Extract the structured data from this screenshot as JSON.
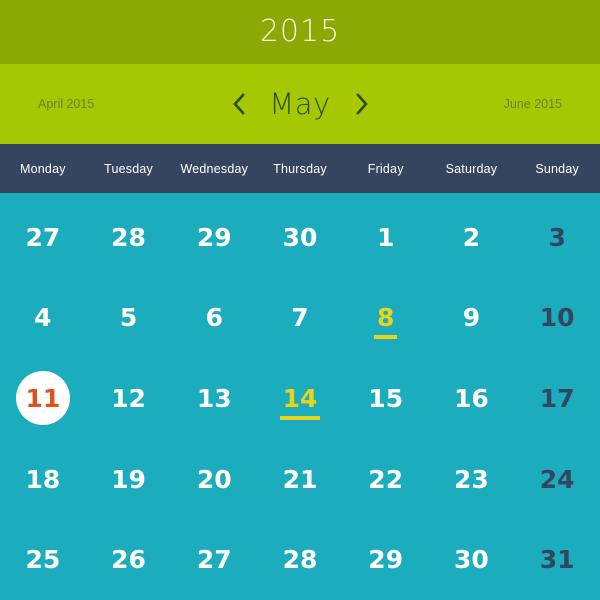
{
  "header": {
    "year": "2015"
  },
  "month_nav": {
    "prev_month_label": "April 2015",
    "next_month_label": "June 2015",
    "current_month": "May",
    "prev_icon": "chevron-left-icon",
    "next_icon": "chevron-right-icon"
  },
  "weekdays": [
    "Monday",
    "Tuesday",
    "Wednesday",
    "Thursday",
    "Friday",
    "Saturday",
    "Sunday"
  ],
  "weeks": [
    [
      {
        "day": "27",
        "state": "outside"
      },
      {
        "day": "28",
        "state": "outside"
      },
      {
        "day": "29",
        "state": "outside"
      },
      {
        "day": "30",
        "state": "outside"
      },
      {
        "day": "1",
        "state": "normal"
      },
      {
        "day": "2",
        "state": "normal"
      },
      {
        "day": "3",
        "state": "weekend"
      }
    ],
    [
      {
        "day": "4",
        "state": "normal"
      },
      {
        "day": "5",
        "state": "normal"
      },
      {
        "day": "6",
        "state": "normal"
      },
      {
        "day": "7",
        "state": "normal"
      },
      {
        "day": "8",
        "state": "marked"
      },
      {
        "day": "9",
        "state": "normal"
      },
      {
        "day": "10",
        "state": "weekend"
      }
    ],
    [
      {
        "day": "11",
        "state": "selected"
      },
      {
        "day": "12",
        "state": "normal"
      },
      {
        "day": "13",
        "state": "normal"
      },
      {
        "day": "14",
        "state": "marked"
      },
      {
        "day": "15",
        "state": "normal"
      },
      {
        "day": "16",
        "state": "normal"
      },
      {
        "day": "17",
        "state": "weekend"
      }
    ],
    [
      {
        "day": "18",
        "state": "normal"
      },
      {
        "day": "19",
        "state": "normal"
      },
      {
        "day": "20",
        "state": "normal"
      },
      {
        "day": "21",
        "state": "normal"
      },
      {
        "day": "22",
        "state": "normal"
      },
      {
        "day": "23",
        "state": "normal"
      },
      {
        "day": "24",
        "state": "weekend"
      }
    ],
    [
      {
        "day": "25",
        "state": "normal"
      },
      {
        "day": "26",
        "state": "normal"
      },
      {
        "day": "27",
        "state": "normal"
      },
      {
        "day": "28",
        "state": "normal"
      },
      {
        "day": "29",
        "state": "normal"
      },
      {
        "day": "30",
        "state": "normal"
      },
      {
        "day": "31",
        "state": "weekend"
      }
    ]
  ],
  "colors": {
    "year_bar_bg": "#8CA802",
    "month_bar_bg": "#A5C803",
    "weekday_bar_bg": "#36455F",
    "grid_bg": "#1BACBE",
    "day_text": "#FFFFFF",
    "weekend_text": "#36455F",
    "marked_accent": "#E8D41B",
    "selected_text": "#D9541E",
    "selected_circle": "#FFFFFF",
    "month_name_text": "#2E4D22",
    "adjacent_month_text": "#6F7F2E",
    "year_text": "#F2F6E2"
  }
}
